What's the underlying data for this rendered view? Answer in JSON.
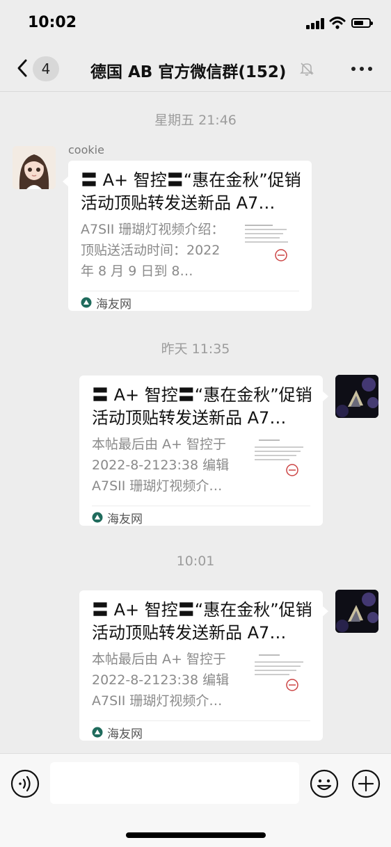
{
  "status_bar": {
    "time": "10:02"
  },
  "nav": {
    "back_label": "",
    "unread_count": "4",
    "title": "德国 AB  官方微信群(152)",
    "icons": [
      "chevron-left-icon",
      "bell-slash-icon",
      "more-icon"
    ]
  },
  "timestamps": [
    "星期五 21:46",
    "昨天 11:35",
    "10:01"
  ],
  "messages": [
    {
      "sender": "cookie",
      "side": "left",
      "title": "〓 A+ 智控〓“惠在金秋”促销活动顶贴转发送新品 A7…",
      "desc": "A7SII 珊瑚灯视频介绍：顶贴送活动时间：2022 年 8 月 9 日到 8…",
      "source": "海友网"
    },
    {
      "sender": "",
      "side": "right",
      "title": "〓 A+ 智控〓“惠在金秋”促销活动顶贴转发送新品 A7…",
      "desc": "本帖最后由 A+ 智控于 2022-8-2123:38 编辑 A7SII 珊瑚灯视频介…",
      "source": "海友网"
    },
    {
      "sender": "",
      "side": "right",
      "title": "〓 A+ 智控〓“惠在金秋”促销活动顶贴转发送新品 A7…",
      "desc": "本帖最后由 A+ 智控于 2022-8-2123:38 编辑 A7SII 珊瑚灯视频介…",
      "source": "海友网"
    }
  ],
  "input_bar": {
    "placeholder": "",
    "icons": [
      "voice-icon",
      "emoji-icon",
      "plus-icon"
    ]
  },
  "colors": {
    "background": "#ededed",
    "bubble": "#ffffff",
    "timestamp": "#9c9c9c",
    "source_icon": "#1f6b5c"
  }
}
